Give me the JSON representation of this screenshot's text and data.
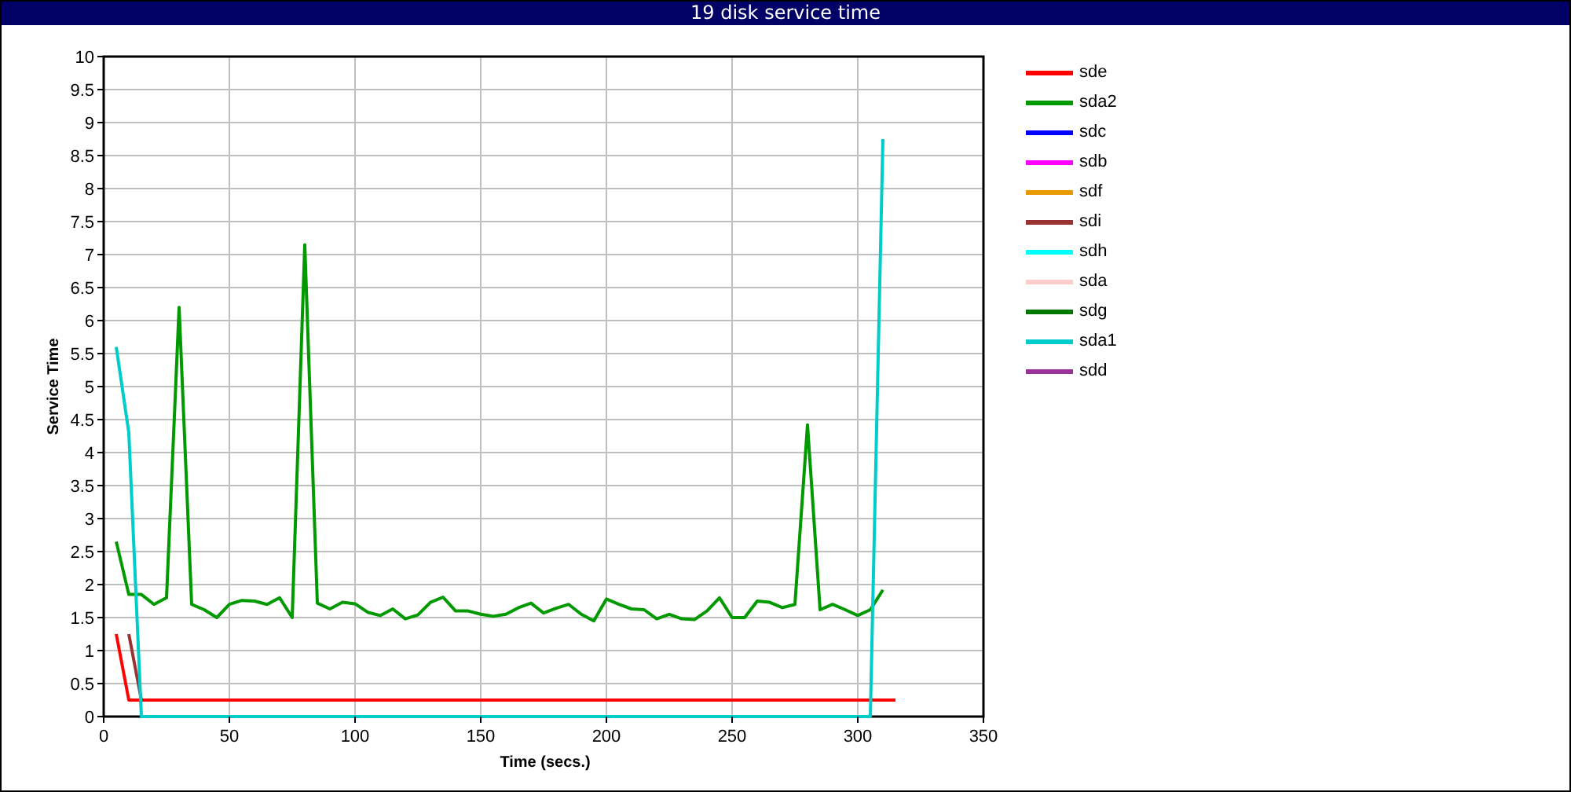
{
  "window": {
    "title": "19 disk service time"
  },
  "chart": {
    "chart_data": {
      "type": "line",
      "grid": true,
      "xlabel": "Time (secs.)",
      "ylabel": "Service Time",
      "xlim": [
        0,
        350
      ],
      "ylim": [
        0,
        10
      ],
      "xticks": [
        0,
        50,
        100,
        150,
        200,
        250,
        300,
        350
      ],
      "yticks": [
        0,
        0.5,
        1,
        1.5,
        2,
        2.5,
        3,
        3.5,
        4,
        4.5,
        5,
        5.5,
        6,
        6.5,
        7,
        7.5,
        8,
        8.5,
        9,
        9.5,
        10
      ],
      "x": [
        5,
        10,
        15,
        20,
        25,
        30,
        35,
        40,
        45,
        50,
        55,
        60,
        65,
        70,
        75,
        80,
        85,
        90,
        95,
        100,
        105,
        110,
        115,
        120,
        125,
        130,
        135,
        140,
        145,
        150,
        155,
        160,
        165,
        170,
        175,
        180,
        185,
        190,
        195,
        200,
        205,
        210,
        215,
        220,
        225,
        230,
        235,
        240,
        245,
        250,
        255,
        260,
        265,
        270,
        275,
        280,
        285,
        290,
        295,
        300,
        305,
        310,
        315
      ],
      "series": [
        {
          "name": "sde",
          "color": "#ff0000",
          "values": [
            1.25,
            0.25,
            0.25,
            0.25,
            0.25,
            0.25,
            0.25,
            0.25,
            0.25,
            0.25,
            0.25,
            0.25,
            0.25,
            0.25,
            0.25,
            0.25,
            0.25,
            0.25,
            0.25,
            0.25,
            0.25,
            0.25,
            0.25,
            0.25,
            0.25,
            0.25,
            0.25,
            0.25,
            0.25,
            0.25,
            0.25,
            0.25,
            0.25,
            0.25,
            0.25,
            0.25,
            0.25,
            0.25,
            0.25,
            0.25,
            0.25,
            0.25,
            0.25,
            0.25,
            0.25,
            0.25,
            0.25,
            0.25,
            0.25,
            0.25,
            0.25,
            0.25,
            0.25,
            0.25,
            0.25,
            0.25,
            0.25,
            0.25,
            0.25,
            0.25,
            0.25,
            0.25,
            0.25
          ]
        },
        {
          "name": "sda2",
          "color": "#009900",
          "values": [
            2.65,
            1.85,
            1.85,
            1.7,
            1.8,
            6.2,
            1.7,
            1.62,
            1.5,
            1.7,
            1.76,
            1.75,
            1.7,
            1.8,
            1.5,
            7.15,
            1.72,
            1.63,
            1.73,
            1.71,
            1.58,
            1.53,
            1.63,
            1.48,
            1.54,
            1.73,
            1.81,
            1.6,
            1.6,
            1.55,
            1.52,
            1.55,
            1.65,
            1.72,
            1.57,
            1.64,
            1.7,
            1.55,
            1.45,
            1.78,
            1.7,
            1.63,
            1.62,
            1.48,
            1.55,
            1.48,
            1.47,
            1.6,
            1.8,
            1.5,
            1.5,
            1.75,
            1.73,
            1.65,
            1.7,
            4.42,
            1.62,
            1.7,
            1.62,
            1.53,
            1.62,
            1.92,
            null
          ]
        },
        {
          "name": "sdc",
          "color": "#0000ff",
          "values": [
            null,
            null,
            null,
            null,
            null,
            null,
            null,
            null,
            null,
            null,
            null,
            null,
            null,
            null,
            null,
            null,
            null,
            null,
            null,
            null,
            null,
            null,
            null,
            null,
            null,
            null,
            null,
            null,
            null,
            null,
            null,
            null,
            null,
            null,
            null,
            null,
            null,
            null,
            null,
            null,
            null,
            null,
            null,
            null,
            null,
            null,
            null,
            null,
            null,
            null,
            null,
            null,
            null,
            null,
            null,
            null,
            null,
            null,
            null,
            null,
            null,
            null,
            null
          ]
        },
        {
          "name": "sdb",
          "color": "#ff00ff",
          "values": [
            null,
            null,
            null,
            null,
            null,
            null,
            null,
            null,
            null,
            null,
            null,
            null,
            null,
            null,
            null,
            null,
            null,
            null,
            null,
            null,
            null,
            null,
            null,
            null,
            null,
            null,
            null,
            null,
            null,
            null,
            null,
            null,
            null,
            null,
            null,
            null,
            null,
            null,
            null,
            null,
            null,
            null,
            null,
            null,
            null,
            null,
            null,
            null,
            null,
            null,
            null,
            null,
            null,
            null,
            null,
            null,
            null,
            null,
            null,
            null,
            null,
            null,
            null
          ]
        },
        {
          "name": "sdf",
          "color": "#e69900",
          "values": [
            null,
            null,
            null,
            null,
            null,
            null,
            null,
            null,
            null,
            null,
            null,
            null,
            null,
            null,
            null,
            null,
            null,
            null,
            null,
            null,
            null,
            null,
            null,
            null,
            null,
            null,
            null,
            null,
            null,
            null,
            null,
            null,
            null,
            null,
            null,
            null,
            null,
            null,
            null,
            null,
            null,
            null,
            null,
            null,
            null,
            null,
            null,
            null,
            null,
            null,
            null,
            null,
            null,
            null,
            null,
            null,
            null,
            null,
            null,
            null,
            null,
            null,
            null
          ]
        },
        {
          "name": "sdi",
          "color": "#993333",
          "values": [
            null,
            1.25,
            0.25,
            null,
            null,
            null,
            null,
            null,
            null,
            null,
            null,
            null,
            null,
            null,
            null,
            null,
            null,
            null,
            null,
            null,
            null,
            null,
            null,
            null,
            null,
            null,
            null,
            null,
            null,
            null,
            null,
            null,
            null,
            null,
            null,
            null,
            null,
            null,
            null,
            null,
            null,
            null,
            null,
            null,
            null,
            null,
            null,
            null,
            null,
            null,
            null,
            null,
            null,
            null,
            null,
            null,
            null,
            null,
            null,
            null,
            null,
            null,
            null
          ]
        },
        {
          "name": "sdh",
          "color": "#00ffff",
          "values": [
            null,
            null,
            null,
            null,
            null,
            null,
            null,
            null,
            null,
            null,
            null,
            null,
            null,
            null,
            null,
            null,
            null,
            null,
            null,
            null,
            null,
            null,
            null,
            null,
            null,
            null,
            null,
            null,
            null,
            null,
            null,
            null,
            null,
            null,
            null,
            null,
            null,
            null,
            null,
            null,
            null,
            null,
            null,
            null,
            null,
            null,
            null,
            null,
            null,
            null,
            null,
            null,
            null,
            null,
            null,
            null,
            null,
            null,
            null,
            null,
            null,
            null,
            null
          ]
        },
        {
          "name": "sda",
          "color": "#ffcccc",
          "values": [
            null,
            null,
            null,
            null,
            null,
            null,
            null,
            null,
            null,
            null,
            null,
            null,
            null,
            null,
            null,
            null,
            null,
            null,
            null,
            null,
            null,
            null,
            null,
            null,
            null,
            null,
            null,
            null,
            null,
            null,
            null,
            null,
            null,
            null,
            null,
            null,
            null,
            null,
            null,
            null,
            null,
            null,
            null,
            null,
            null,
            null,
            null,
            null,
            null,
            null,
            null,
            null,
            null,
            null,
            null,
            null,
            null,
            null,
            null,
            null,
            null,
            null,
            null
          ]
        },
        {
          "name": "sdg",
          "color": "#007700",
          "values": [
            null,
            null,
            null,
            null,
            null,
            null,
            null,
            null,
            null,
            null,
            null,
            null,
            null,
            null,
            null,
            null,
            null,
            null,
            null,
            null,
            null,
            null,
            null,
            null,
            null,
            null,
            null,
            null,
            null,
            null,
            null,
            null,
            null,
            null,
            null,
            null,
            null,
            null,
            null,
            null,
            null,
            null,
            null,
            null,
            null,
            null,
            null,
            null,
            null,
            null,
            null,
            null,
            null,
            null,
            null,
            null,
            null,
            null,
            null,
            null,
            null,
            null,
            null
          ]
        },
        {
          "name": "sda1",
          "color": "#00cccc",
          "values": [
            5.6,
            4.3,
            0,
            0,
            0,
            0,
            0,
            0,
            0,
            0,
            0,
            0,
            0,
            0,
            0,
            0,
            0,
            0,
            0,
            0,
            0,
            0,
            0,
            0,
            0,
            0,
            0,
            0,
            0,
            0,
            0,
            0,
            0,
            0,
            0,
            0,
            0,
            0,
            0,
            0,
            0,
            0,
            0,
            0,
            0,
            0,
            0,
            0,
            0,
            0,
            0,
            0,
            0,
            0,
            0,
            0,
            0,
            0,
            0,
            0,
            0,
            8.75,
            null
          ]
        },
        {
          "name": "sdd",
          "color": "#993399",
          "values": [
            null,
            null,
            null,
            null,
            null,
            null,
            null,
            null,
            null,
            null,
            null,
            null,
            null,
            null,
            null,
            null,
            null,
            null,
            null,
            null,
            null,
            null,
            null,
            null,
            null,
            null,
            null,
            null,
            null,
            null,
            null,
            null,
            null,
            null,
            null,
            null,
            null,
            null,
            null,
            null,
            null,
            null,
            null,
            null,
            null,
            null,
            null,
            null,
            null,
            null,
            null,
            null,
            null,
            null,
            null,
            null,
            null,
            null,
            null,
            null,
            null,
            null,
            null
          ]
        }
      ]
    }
  }
}
